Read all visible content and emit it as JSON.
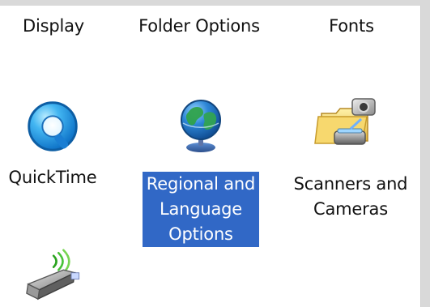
{
  "window": {
    "accent_color": "#3168c6"
  },
  "icons": [
    {
      "label": "Display",
      "icon": "display-icon",
      "selected": false
    },
    {
      "label": "Folder Options",
      "icon": "folder-options-icon",
      "selected": false
    },
    {
      "label": "Fonts",
      "icon": "fonts-icon",
      "selected": false
    },
    {
      "label": "QuickTime",
      "icon": "quicktime-icon",
      "selected": false
    },
    {
      "label_lines": [
        "Regional and",
        "Language",
        "Options"
      ],
      "icon": "globe-icon",
      "selected": true
    },
    {
      "label_lines": [
        "Scanners and",
        "Cameras"
      ],
      "icon": "scanners-cameras-icon",
      "selected": false
    },
    {
      "label": "",
      "icon": "wireless-usb-device-icon",
      "selected": false
    }
  ]
}
